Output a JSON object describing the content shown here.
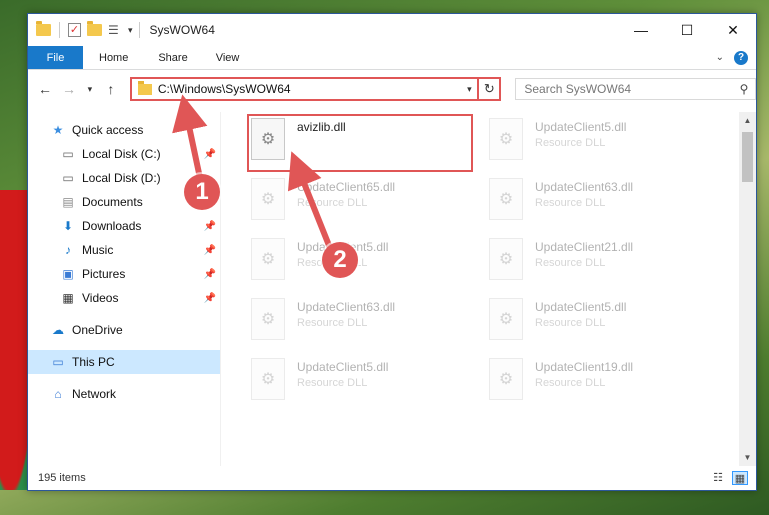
{
  "window": {
    "title": "SysWOW64"
  },
  "ribbon": {
    "tabs": [
      "File",
      "Home",
      "Share",
      "View"
    ]
  },
  "nav": {
    "address": "C:\\Windows\\SysWOW64",
    "search_placeholder": "Search SysWOW64"
  },
  "sidebar": {
    "quick_access": "Quick access",
    "items": [
      {
        "label": "Local Disk (C:)",
        "icon": "drive-icon",
        "pinned": true
      },
      {
        "label": "Local Disk (D:)",
        "icon": "drive-icon",
        "pinned": false
      },
      {
        "label": "Documents",
        "icon": "documents-icon",
        "pinned": true
      },
      {
        "label": "Downloads",
        "icon": "download-icon",
        "pinned": true
      },
      {
        "label": "Music",
        "icon": "music-icon",
        "pinned": true
      },
      {
        "label": "Pictures",
        "icon": "pictures-icon",
        "pinned": true
      },
      {
        "label": "Videos",
        "icon": "videos-icon",
        "pinned": true
      }
    ],
    "onedrive": "OneDrive",
    "this_pc": "This PC",
    "network": "Network"
  },
  "files": [
    {
      "name": "avizlib.dll",
      "type": ""
    },
    {
      "name": "UpdateClient5.dll",
      "type": "Resource DLL"
    },
    {
      "name": "UpdateClient65.dll",
      "type": "Resource DLL"
    },
    {
      "name": "UpdateClient63.dll",
      "type": "Resource DLL"
    },
    {
      "name": "UpdateClient5.dll",
      "type": "Resource DLL"
    },
    {
      "name": "UpdateClient21.dll",
      "type": "Resource DLL"
    },
    {
      "name": "UpdateClient63.dll",
      "type": "Resource DLL"
    },
    {
      "name": "UpdateClient5.dll",
      "type": "Resource DLL"
    },
    {
      "name": "UpdateClient5.dll",
      "type": "Resource DLL"
    },
    {
      "name": "UpdateClient19.dll",
      "type": "Resource DLL"
    }
  ],
  "status": {
    "item_count": "195 items"
  },
  "callouts": [
    "1",
    "2"
  ],
  "colors": {
    "accent": "#1979ca",
    "highlight": "#e05656",
    "selection": "#cce8ff"
  }
}
